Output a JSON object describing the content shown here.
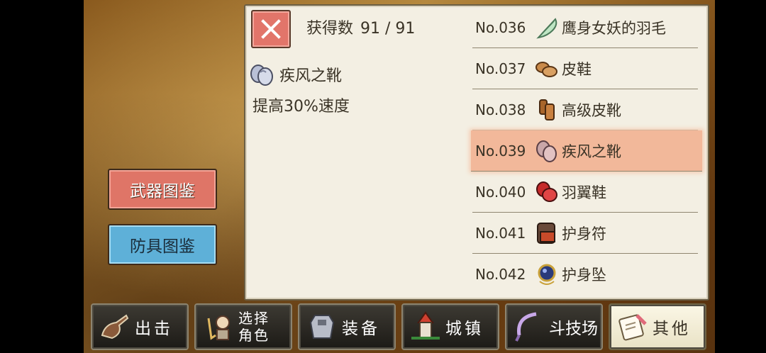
{
  "header": {
    "count_label": "获得数",
    "count_value": "91 / 91"
  },
  "detail": {
    "name": "疾风之靴",
    "description": "提高30%速度",
    "icon": "boots-icon"
  },
  "list": [
    {
      "no": "No.036",
      "name": "鹰身女妖的羽毛",
      "icon": "feather-icon"
    },
    {
      "no": "No.037",
      "name": "皮鞋",
      "icon": "leather-shoes-icon"
    },
    {
      "no": "No.038",
      "name": "高级皮靴",
      "icon": "boots-icon"
    },
    {
      "no": "No.039",
      "name": "疾风之靴",
      "icon": "wind-boots-icon",
      "selected": true
    },
    {
      "no": "No.040",
      "name": "羽翼鞋",
      "icon": "winged-shoes-icon"
    },
    {
      "no": "No.041",
      "name": "护身符",
      "icon": "talisman-icon"
    },
    {
      "no": "No.042",
      "name": "护身坠",
      "icon": "amulet-icon"
    }
  ],
  "side_buttons": {
    "weapon": "武器图鉴",
    "armor": "防具图鉴"
  },
  "tabs": [
    {
      "label": "出击",
      "icon": "sortie-icon"
    },
    {
      "label_line1": "选择",
      "label_line2": "角色",
      "icon": "character-icon"
    },
    {
      "label": "装备",
      "icon": "equipment-icon"
    },
    {
      "label": "城镇",
      "icon": "town-icon"
    },
    {
      "label": "斗技场",
      "icon": "arena-icon"
    },
    {
      "label": "其他",
      "icon": "scroll-icon",
      "active": true
    }
  ],
  "colors": {
    "panel": "#f3efe3",
    "close_button": "#e2756a",
    "weapon_button": "#df7567",
    "armor_button": "#5eb0d8",
    "selected_row": "#f2b89a"
  }
}
